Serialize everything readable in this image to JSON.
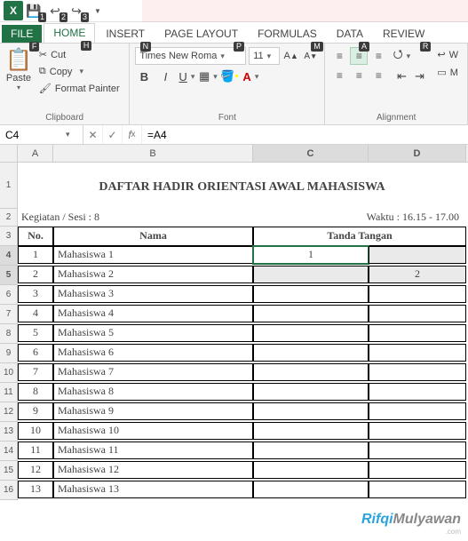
{
  "qat": {
    "k1": "1",
    "k2": "2",
    "k3": "3"
  },
  "tabs": {
    "file": "FILE",
    "home": "HOME",
    "insert": "INSERT",
    "page": "PAGE LAYOUT",
    "formulas": "FORMULAS",
    "data": "DATA",
    "review": "REVIEW",
    "kF": "F",
    "kH": "H",
    "kN": "N",
    "kP": "P",
    "kM": "M",
    "kA": "A",
    "kR": "R"
  },
  "clipboard": {
    "cut": "Cut",
    "copy": "Copy",
    "fpaint": "Format Painter",
    "paste": "Paste",
    "group": "Clipboard"
  },
  "font": {
    "name": "Times New Roma",
    "size": "11",
    "group": "Font"
  },
  "align": {
    "group": "Alignment"
  },
  "namebox": "C4",
  "formula": "=A4",
  "cols": {
    "A": "A",
    "B": "B",
    "C": "C",
    "D": "D"
  },
  "rows": [
    "1",
    "2",
    "3",
    "4",
    "5",
    "6",
    "7",
    "8",
    "9",
    "10",
    "11",
    "12",
    "13",
    "14",
    "15",
    "16"
  ],
  "doc": {
    "title": "DAFTAR HADIR ORIENTASI AWAL MAHASISWA",
    "meta_left": "Kegiatan / Sesi : 8",
    "meta_right": "Waktu : 16.15 - 17.00",
    "hdr_no": "No.",
    "hdr_nama": "Nama",
    "hdr_ttd": "Tanda Tangan",
    "rows": [
      {
        "no": "1",
        "nama": "Mahasiswa 1",
        "s1": "1",
        "s2": ""
      },
      {
        "no": "2",
        "nama": "Mahasiswa 2",
        "s1": "",
        "s2": "2"
      },
      {
        "no": "3",
        "nama": "Mahasiswa 3",
        "s1": "",
        "s2": ""
      },
      {
        "no": "4",
        "nama": "Mahasiswa 4",
        "s1": "",
        "s2": ""
      },
      {
        "no": "5",
        "nama": "Mahasiswa 5",
        "s1": "",
        "s2": ""
      },
      {
        "no": "6",
        "nama": "Mahasiswa 6",
        "s1": "",
        "s2": ""
      },
      {
        "no": "7",
        "nama": "Mahasiswa 7",
        "s1": "",
        "s2": ""
      },
      {
        "no": "8",
        "nama": "Mahasiswa 8",
        "s1": "",
        "s2": ""
      },
      {
        "no": "9",
        "nama": "Mahasiswa 9",
        "s1": "",
        "s2": ""
      },
      {
        "no": "10",
        "nama": "Mahasiswa 10",
        "s1": "",
        "s2": ""
      },
      {
        "no": "11",
        "nama": "Mahasiswa 11",
        "s1": "",
        "s2": ""
      },
      {
        "no": "12",
        "nama": "Mahasiswa 12",
        "s1": "",
        "s2": ""
      },
      {
        "no": "13",
        "nama": "Mahasiswa 13",
        "s1": "",
        "s2": ""
      }
    ]
  },
  "watermark": {
    "p1": "Rifqi",
    "p2": "Mulyawan",
    "sub": ".com"
  }
}
